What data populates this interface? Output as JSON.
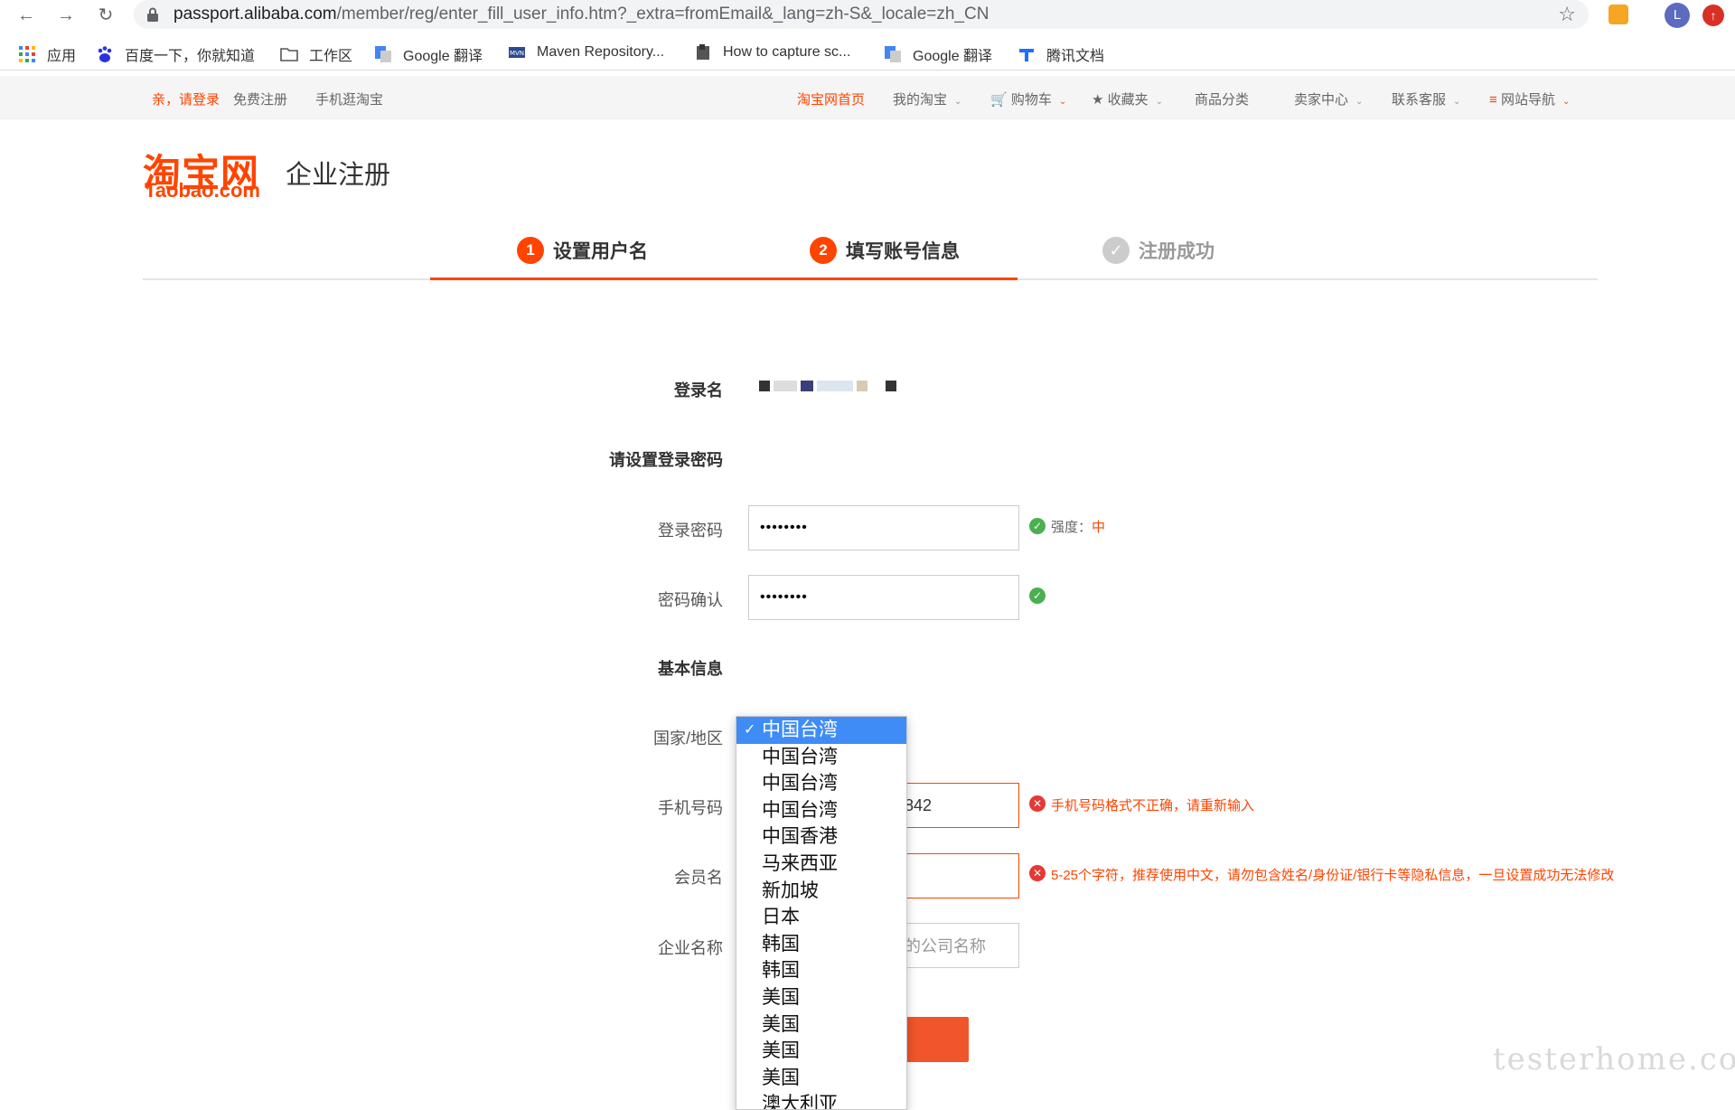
{
  "browser": {
    "url_host": "passport.alibaba.com",
    "url_path": "/member/reg/enter_fill_user_info.htm?_extra=fromEmail&_lang=zh-S&_locale=zh_CN",
    "avatar_letter": "L"
  },
  "bookmarks": [
    {
      "label": "应用",
      "icon": "apps-grid-icon"
    },
    {
      "label": "百度一下，你就知道",
      "icon": "baidu-paw-icon"
    },
    {
      "label": "工作区",
      "icon": "folder-icon"
    },
    {
      "label": "Google 翻译",
      "icon": "google-translate-icon"
    },
    {
      "label": "Maven Repository...",
      "icon": "maven-icon"
    },
    {
      "label": "How to capture sc...",
      "icon": "page-icon"
    },
    {
      "label": "Google 翻译",
      "icon": "google-translate-icon"
    },
    {
      "label": "腾讯文档",
      "icon": "tencent-docs-icon"
    }
  ],
  "site_nav": {
    "login": "亲，请登录",
    "register": "免费注册",
    "mobile": "手机逛淘宝",
    "home": "淘宝网首页",
    "my_taobao": "我的淘宝",
    "cart": "购物车",
    "favorites": "收藏夹",
    "categories": "商品分类",
    "seller": "卖家中心",
    "service": "联系客服",
    "sitemap": "网站导航"
  },
  "header": {
    "logo_cn": "淘宝网",
    "logo_en": "Taobao.com",
    "title": "企业注册"
  },
  "steps": [
    {
      "num": "1",
      "label": "设置用户名"
    },
    {
      "num": "2",
      "label": "填写账号信息"
    },
    {
      "num": "",
      "label": "注册成功"
    }
  ],
  "form": {
    "login_name_label": "登录名",
    "password_section": "请设置登录密码",
    "password_label": "登录密码",
    "password_value": "••••••••",
    "strength_label": "强度：",
    "strength_value": "中",
    "confirm_label": "密码确认",
    "confirm_value": "••••••••",
    "basic_section": "基本信息",
    "country_label": "国家/地区",
    "phone_label": "手机号码",
    "phone_value": "842",
    "phone_error": "手机号码格式不正确，请重新输入",
    "member_label": "会员名",
    "member_hint": "5-25个字符，推荐使用中文，请勿包含姓名/身份证/银行卡等隐私信息，一旦设置成功无法修改",
    "company_label": "企业名称",
    "company_placeholder": "的公司名称"
  },
  "country_dropdown": {
    "selected_index": 0,
    "options": [
      "中国台湾",
      "中国台湾",
      "中国台湾",
      "中国台湾",
      "中国香港",
      "马来西亚",
      "新加坡",
      "日本",
      "韩国",
      "韩国",
      "美国",
      "美国",
      "美国",
      "美国",
      "澳大利亚"
    ]
  },
  "watermark": "testerhome.com",
  "colors": {
    "brand": "#ff4400",
    "select_highlight": "#3f8cf7",
    "success": "#4caf50",
    "error": "#e53935"
  }
}
